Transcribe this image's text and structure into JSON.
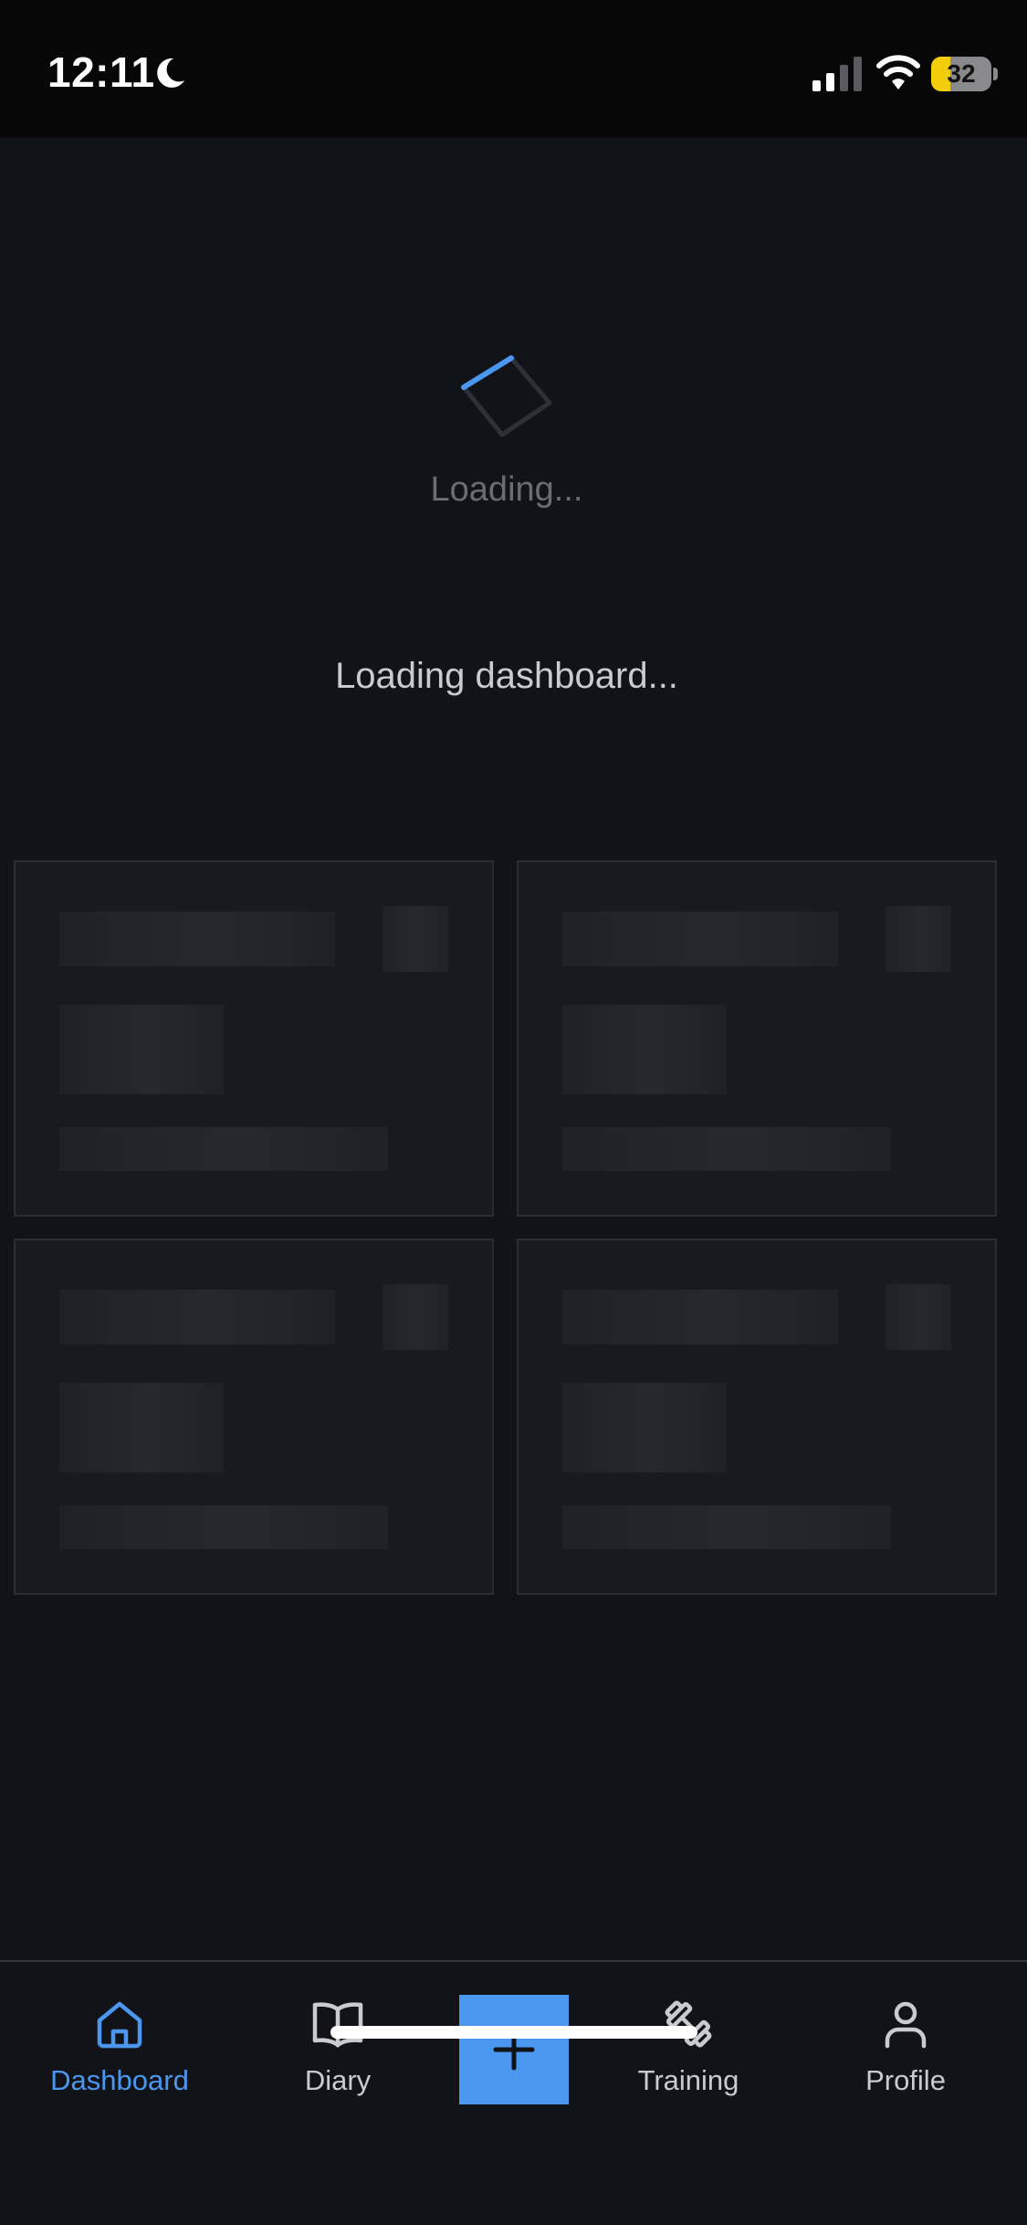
{
  "status_bar": {
    "time": "12:11",
    "battery_percent": "32",
    "battery_level": 0.32
  },
  "loader": {
    "text": "Loading...",
    "message": "Loading dashboard..."
  },
  "skeleton": {
    "card_count": 4
  },
  "bottom_nav": {
    "items": [
      {
        "label": "Dashboard",
        "icon": "home-icon",
        "active": true
      },
      {
        "label": "Diary",
        "icon": "book-open-icon",
        "active": false
      },
      {
        "label": "Training",
        "icon": "dumbbell-icon",
        "active": false
      },
      {
        "label": "Profile",
        "icon": "user-icon",
        "active": false
      }
    ],
    "add_icon": "plus-icon"
  },
  "colors": {
    "accent": "#4a97f0",
    "background": "#121318",
    "status_bar": "#070708",
    "card": "#181a21",
    "battery": "#f2cd0c"
  }
}
